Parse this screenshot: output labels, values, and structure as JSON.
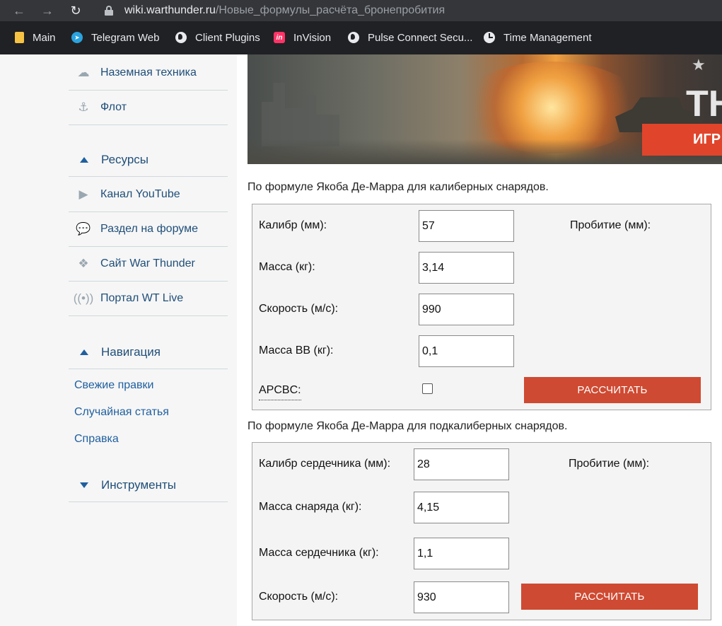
{
  "browser": {
    "domain": "wiki.warthunder.ru",
    "path": "/Новые_формулы_расчёта_бронепробития",
    "bookmarks": [
      {
        "label": "Main",
        "icon": "folder-icon"
      },
      {
        "label": "Telegram Web",
        "icon": "telegram-icon"
      },
      {
        "label": "Client Plugins",
        "icon": "globe-icon"
      },
      {
        "label": "InVision",
        "icon": "invision-icon",
        "icon_text": "in"
      },
      {
        "label": "Pulse Connect Secu...",
        "icon": "globe-icon"
      },
      {
        "label": "Time Management",
        "icon": "clock-icon"
      }
    ]
  },
  "sidebar": {
    "top_items": [
      {
        "label": "Наземная техника",
        "icon": "cloud-tank-icon"
      },
      {
        "label": "Флот",
        "icon": "anchor-icon"
      }
    ],
    "resources": {
      "heading": "Ресурсы",
      "items": [
        {
          "label": "Канал YouTube",
          "icon": "youtube-icon"
        },
        {
          "label": "Раздел на форуме",
          "icon": "forum-icon"
        },
        {
          "label": "Сайт War Thunder",
          "icon": "war-thunder-icon"
        },
        {
          "label": "Портал WT Live",
          "icon": "broadcast-icon"
        }
      ]
    },
    "navigation": {
      "heading": "Навигация",
      "links": [
        "Свежие правки",
        "Случайная статья",
        "Справка"
      ]
    },
    "tools": {
      "heading": "Инструменты"
    }
  },
  "banner": {
    "title_fragment": "TH",
    "button_fragment": "ИГР"
  },
  "calibre_form": {
    "caption": "По формуле Якоба Де-Марра для калиберных снарядов.",
    "fields": [
      {
        "label": "Калибр (мм):",
        "value": "57"
      },
      {
        "label": "Масса (кг):",
        "value": "3,14"
      },
      {
        "label": "Скорость (м/с):",
        "value": "990"
      },
      {
        "label": "Масса ВВ (кг):",
        "value": "0,1"
      }
    ],
    "checkbox_label": "APCBC:",
    "checkbox_checked": false,
    "result_label": "Пробитие (мм):",
    "button": "РАССЧИТАТЬ"
  },
  "subcalibre_form": {
    "caption": "По формуле Якоба Де-Марра для подкалиберных снарядов.",
    "fields": [
      {
        "label": "Калибр сердечника (мм):",
        "value": "28"
      },
      {
        "label": "Масса снаряда (кг):",
        "value": "4,15"
      },
      {
        "label": "Масса сердечника (кг):",
        "value": "1,1"
      },
      {
        "label": "Скорость (м/с):",
        "value": "930"
      }
    ],
    "result_label": "Пробитие (мм):",
    "button": "РАССЧИТАТЬ"
  }
}
